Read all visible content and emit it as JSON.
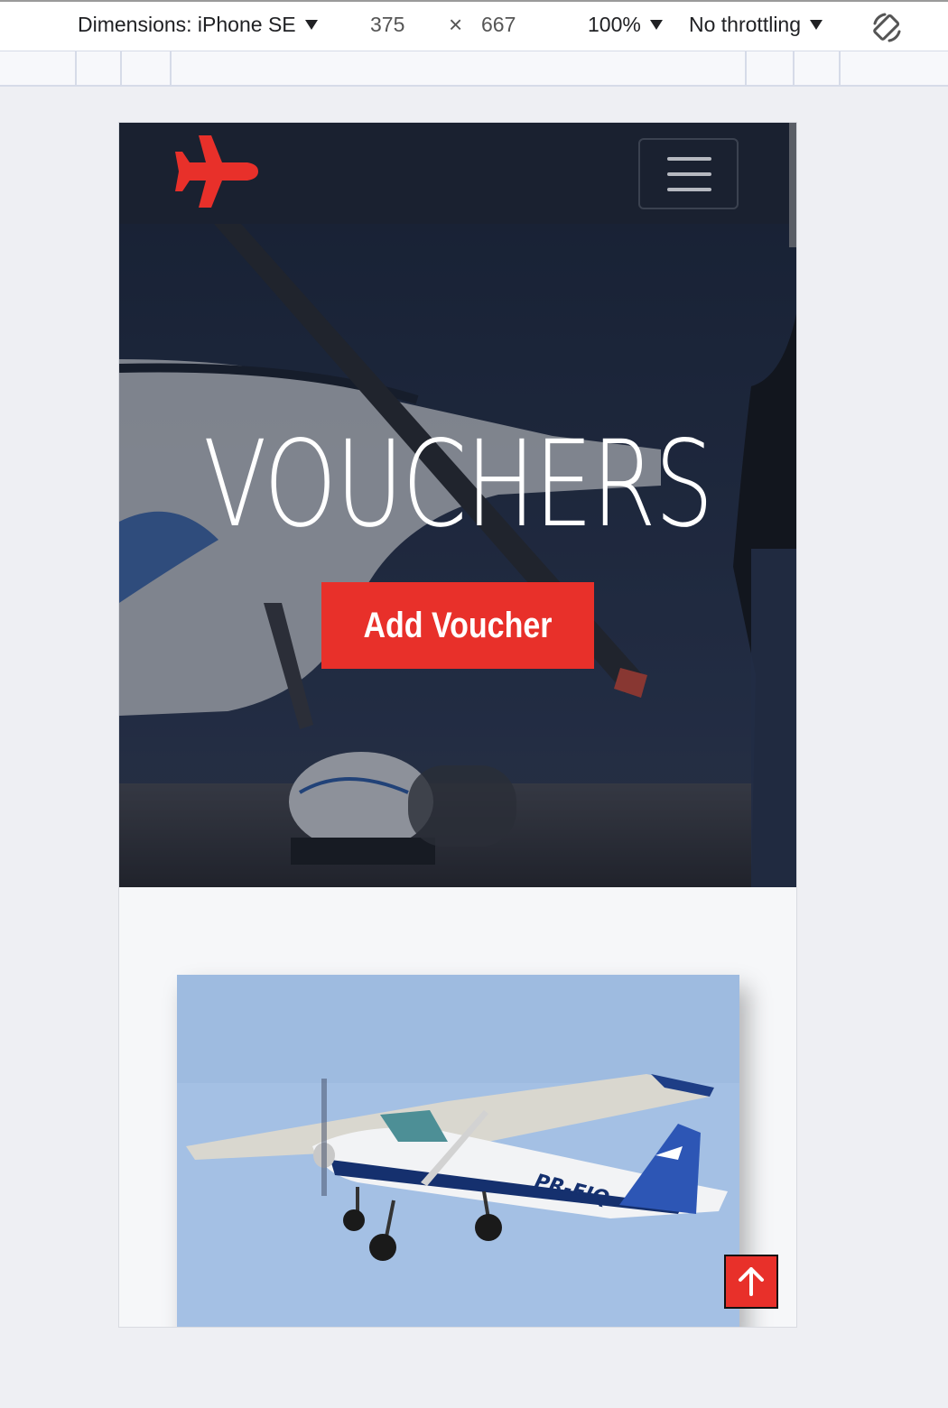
{
  "devtools": {
    "device_label": "Dimensions: iPhone SE",
    "width": "375",
    "times": "×",
    "height": "667",
    "zoom": "100%",
    "throttling": "No throttling",
    "rotate_icon": "rotate-icon"
  },
  "site": {
    "logo_icon": "airplane-icon",
    "menu_icon": "hamburger-icon",
    "hero": {
      "title": "VOUCHERS",
      "button_label": "Add Voucher"
    },
    "card": {
      "image": "airplane-photo",
      "registration": "PR-EJQ"
    },
    "back_to_top_icon": "arrow-up-icon"
  },
  "colors": {
    "accent": "#e8302a",
    "navbar": "#1a2130",
    "page_bg": "#f6f7f9"
  }
}
